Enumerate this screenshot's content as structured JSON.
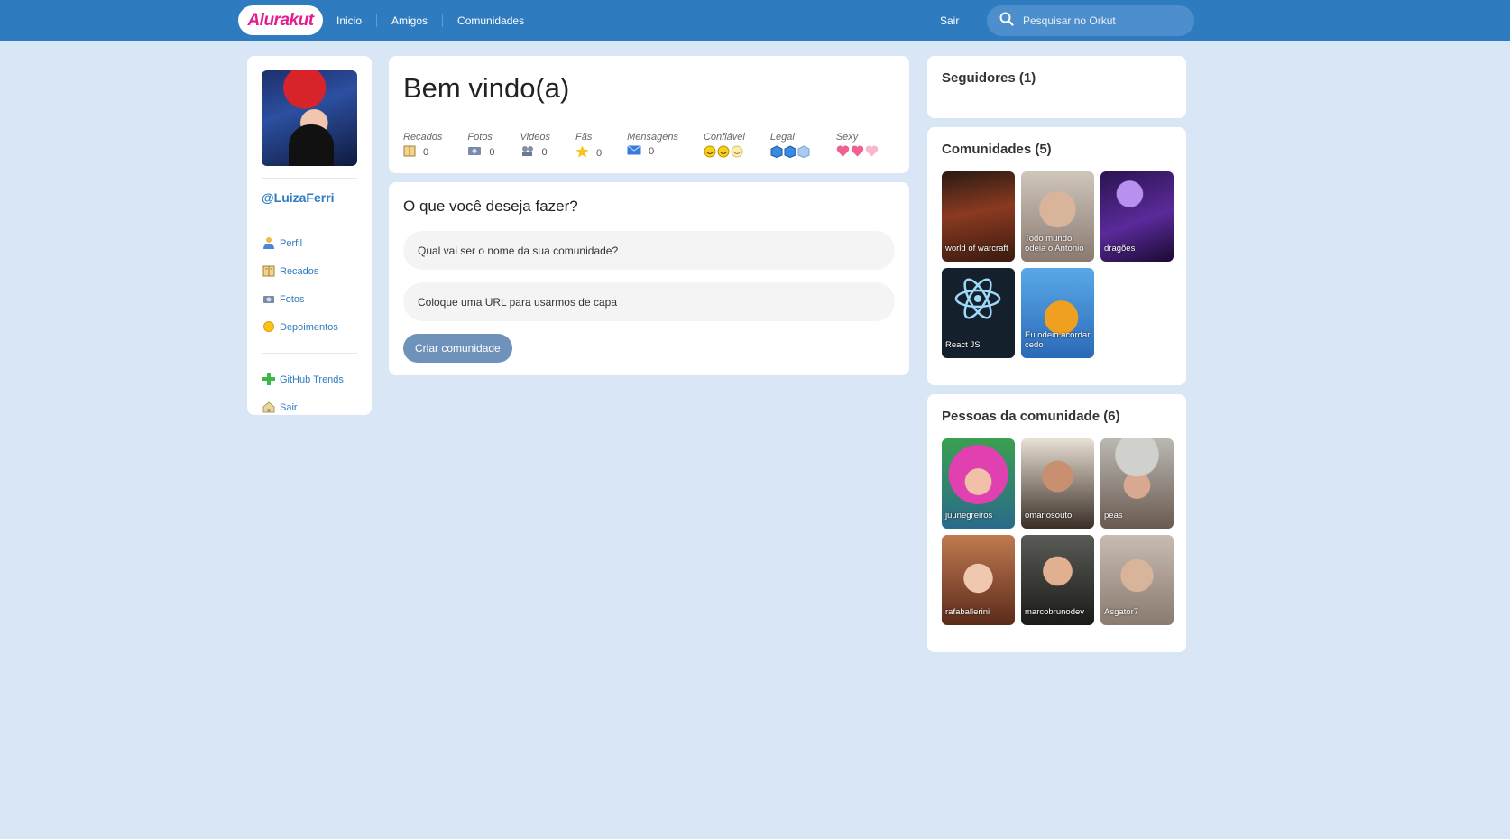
{
  "header": {
    "logo": "Alurakut",
    "nav": [
      "Inicio",
      "Amigos",
      "Comunidades"
    ],
    "logout": "Sair",
    "search_placeholder": "Pesquisar no Orkut",
    "colors": {
      "bar": "#2e7bbf",
      "logo": "#e31d8f"
    }
  },
  "sidebar": {
    "username": "@LuizaFerri",
    "items": [
      {
        "label": "Perfil",
        "icon": "user-icon"
      },
      {
        "label": "Recados",
        "icon": "book-icon"
      },
      {
        "label": "Fotos",
        "icon": "camera-icon"
      },
      {
        "label": "Depoimentos",
        "icon": "sun-icon"
      }
    ],
    "extra": [
      {
        "label": "GitHub Trends",
        "icon": "plus-icon"
      },
      {
        "label": "Sair",
        "icon": "logout-icon"
      }
    ]
  },
  "welcome": {
    "title": "Bem vindo(a)",
    "stats": [
      {
        "label": "Recados",
        "value": "0",
        "icon": "book-icon"
      },
      {
        "label": "Fotos",
        "value": "0",
        "icon": "camera-icon"
      },
      {
        "label": "Videos",
        "value": "0",
        "icon": "video-icon"
      },
      {
        "label": "Fãs",
        "value": "0",
        "icon": "star-icon"
      },
      {
        "label": "Mensagens",
        "value": "0",
        "icon": "mail-icon"
      }
    ],
    "ratings": [
      {
        "label": "Confiável",
        "icon": "smiley-icon",
        "filled": 2,
        "max": 3
      },
      {
        "label": "Legal",
        "icon": "ice-cube-icon",
        "filled": 2,
        "max": 3
      },
      {
        "label": "Sexy",
        "icon": "heart-icon",
        "filled": 2,
        "max": 3
      }
    ]
  },
  "form": {
    "title": "O que você deseja fazer?",
    "name_placeholder": "Qual vai ser o nome da sua comunidade?",
    "url_placeholder": "Coloque uma URL para usarmos de capa",
    "submit": "Criar comunidade"
  },
  "followers": {
    "title": "Seguidores (1)"
  },
  "communities": {
    "title": "Comunidades (5)",
    "items": [
      {
        "name": "world of warcraft",
        "color": "#5a2a1c"
      },
      {
        "name": "Todo mundo odeia o Antonio",
        "color": "#b8a89a"
      },
      {
        "name": "dragões",
        "color": "#4a2a7a"
      },
      {
        "name": "React JS",
        "color": "#1a2330"
      },
      {
        "name": "Eu odeio acordar cedo",
        "color": "#3a86c8"
      }
    ]
  },
  "people": {
    "title": "Pessoas da comunidade (6)",
    "items": [
      {
        "name": "juunegreiros",
        "color": "#c93aa8"
      },
      {
        "name": "omariosouto",
        "color": "#6b5a4a"
      },
      {
        "name": "peas",
        "color": "#8a8a86"
      },
      {
        "name": "rafaballerini",
        "color": "#a8604a"
      },
      {
        "name": "marcobrunodev",
        "color": "#3a3a38"
      },
      {
        "name": "Asgator7",
        "color": "#9a8a80"
      }
    ]
  }
}
